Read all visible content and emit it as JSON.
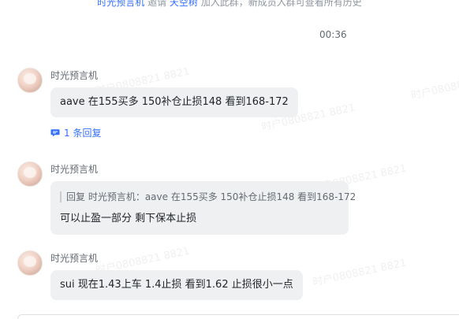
{
  "system_notice": {
    "prefix": "时光预言机",
    "mid": " 邀请 ",
    "user": "天空树",
    "suffix": " 加入此群，新成员入群可查看所有历史"
  },
  "time_separator": "00:36",
  "watermark_text": "时户0808821 8821",
  "messages": [
    {
      "sender": "时光预言机",
      "text": "aave 在155买多 150补仓止损148 看到168-172",
      "reply_count_label": "1 条回复"
    },
    {
      "sender": "时光预言机",
      "quote": "回复 时光预言机：aave 在155买多 150补仓止损148 看到168-172",
      "text": "可以止盈一部分 剩下保本止损"
    },
    {
      "sender": "时光预言机",
      "text": "sui 现在1.43上车 1.4止损 看到1.62 止损很小一点"
    }
  ],
  "colors": {
    "link": "#3370ff",
    "bubble": "#eff0f1",
    "muted": "#646a73"
  }
}
